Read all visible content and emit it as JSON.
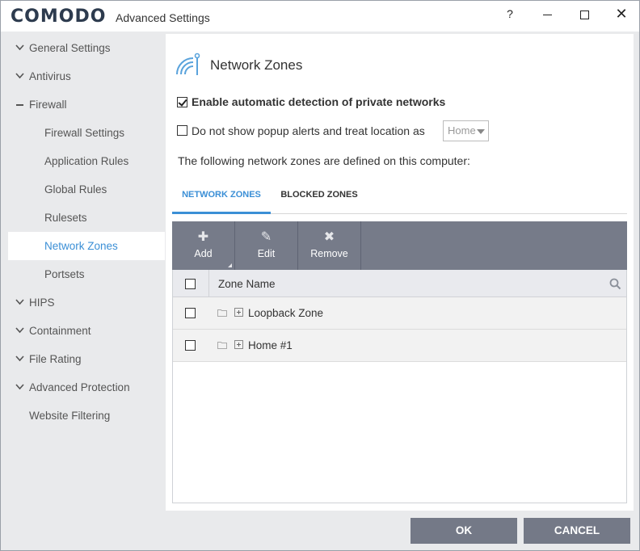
{
  "titlebar": {
    "logo": "COMODO",
    "title": "Advanced Settings",
    "help": "?",
    "close": "✕"
  },
  "sidebar": {
    "items": [
      {
        "label": "General Settings",
        "state": "collapsed"
      },
      {
        "label": "Antivirus",
        "state": "collapsed"
      },
      {
        "label": "Firewall",
        "state": "expanded"
      },
      {
        "label": "Firewall Settings"
      },
      {
        "label": "Application Rules"
      },
      {
        "label": "Global Rules"
      },
      {
        "label": "Rulesets"
      },
      {
        "label": "Network Zones",
        "active": true
      },
      {
        "label": "Portsets"
      },
      {
        "label": "HIPS",
        "state": "collapsed"
      },
      {
        "label": "Containment",
        "state": "collapsed"
      },
      {
        "label": "File Rating",
        "state": "collapsed"
      },
      {
        "label": "Advanced Protection",
        "state": "collapsed"
      },
      {
        "label": "Website Filtering"
      }
    ]
  },
  "main": {
    "title": "Network Zones",
    "auto_detect_label": "Enable automatic detection of private networks",
    "auto_detect_checked": true,
    "popup_label": "Do not show popup alerts and treat location as",
    "popup_checked": false,
    "location_select": "Home",
    "description": "The following network zones are defined on this computer:",
    "tabs": [
      {
        "label": "NETWORK ZONES",
        "active": true
      },
      {
        "label": "BLOCKED ZONES",
        "active": false
      }
    ],
    "toolbar": {
      "add": "Add",
      "edit": "Edit",
      "remove": "Remove"
    },
    "table": {
      "column": "Zone Name",
      "rows": [
        {
          "name": "Loopback Zone"
        },
        {
          "name": "Home #1"
        }
      ]
    }
  },
  "footer": {
    "ok": "OK",
    "cancel": "CANCEL"
  },
  "colors": {
    "accent": "#3b8fd6",
    "toolbar": "#767b89",
    "button": "#747987"
  }
}
